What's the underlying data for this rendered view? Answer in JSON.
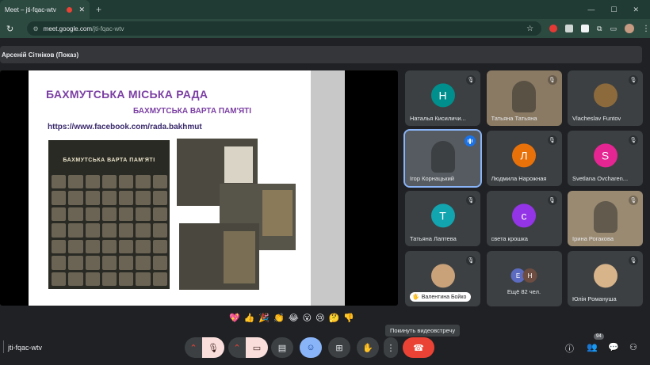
{
  "browser": {
    "tab_title": "Meet – jti-fqac-wtv",
    "url_host": "meet.google.com",
    "url_path": "/jti-fqac-wtv"
  },
  "presenter": {
    "label": "Арсеній Сітніков (Показ)"
  },
  "slide": {
    "title": "БАХМУТСЬКА МІСЬКА РАДА",
    "subtitle": "БАХМУТСЬКА ВАРТА ПАМ'ЯТІ",
    "link": "https://www.facebook.com/rada.bakhmut",
    "poster_banner": "БАХМУТСЬКА ВАРТА ПАМ'ЯТІ"
  },
  "participants": [
    {
      "name": "Наталья Кисиличи...",
      "initial": "Н",
      "color": "#008f8c",
      "type": "avatar"
    },
    {
      "name": "Татьяна Татьяна",
      "initial": "",
      "color": "#8a7a64",
      "type": "video"
    },
    {
      "name": "Vlacheslav Funtov",
      "initial": "",
      "color": "#8c6a3c",
      "type": "photo"
    },
    {
      "name": "Ігор Корнацький",
      "initial": "",
      "color": "#555b60",
      "type": "video"
    },
    {
      "name": "Людмила Нарожная",
      "initial": "Л",
      "color": "#e8710a",
      "type": "avatar"
    },
    {
      "name": "Svetlana Ovcharen...",
      "initial": "S",
      "color": "#e52592",
      "type": "avatar"
    },
    {
      "name": "Татьяна Лаптева",
      "initial": "Т",
      "color": "#12a4af",
      "type": "avatar"
    },
    {
      "name": "света крошка",
      "initial": "с",
      "color": "#9334e6",
      "type": "avatar"
    },
    {
      "name": "Ірина Рогакова",
      "initial": "",
      "color": "#9a8a72",
      "type": "video"
    },
    {
      "name": "Валентина Бойко",
      "initial": "",
      "color": "#c9a27a",
      "type": "photo"
    },
    {
      "name": "Ещё 82 чел.",
      "initial": "",
      "color": "#3c4043",
      "type": "more",
      "stack": [
        "E",
        "Н"
      ]
    },
    {
      "name": "Юлія Романуша",
      "initial": "",
      "color": "#d8b48a",
      "type": "photo"
    }
  ],
  "reactions": [
    "💖",
    "👍",
    "🎉",
    "👏",
    "😂",
    "😮",
    "😢",
    "🤔",
    "👎"
  ],
  "toolbar": {
    "meeting_code": "jti-fqac-wtv",
    "leave_tooltip": "Покинуть видеовстречу",
    "participants_count": "94"
  },
  "colors": {
    "leave_red": "#ea4335",
    "muted_pink": "#f9dedc",
    "active_blue": "#8ab4f8"
  }
}
